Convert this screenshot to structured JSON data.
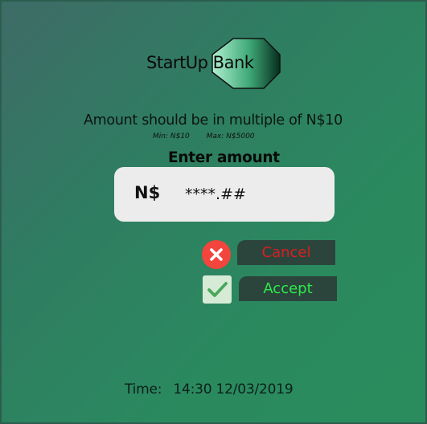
{
  "bank": {
    "name": "StartUp Bank"
  },
  "screen": {
    "headline": "Amount should be in multiple of N$10",
    "min_label": "Min: N$10",
    "max_label": "Max: N$5000",
    "enter_label": "Enter amount"
  },
  "amount_field": {
    "currency": "N$",
    "placeholder": "****.##"
  },
  "actions": {
    "cancel_label": "Cancel",
    "accept_label": "Accept"
  },
  "footer": {
    "time_label": "Time:",
    "time_value": "14:30 12/03/2019"
  },
  "icons": {
    "cancel": "close-icon",
    "accept": "checkmark-icon",
    "logo": "bank-logo-icon"
  },
  "colors": {
    "cancel_text": "#d91f1f",
    "accept_text": "#2ee84a",
    "cancel_icon_bg": "#f2453d",
    "button_bg": "#2b453d"
  }
}
